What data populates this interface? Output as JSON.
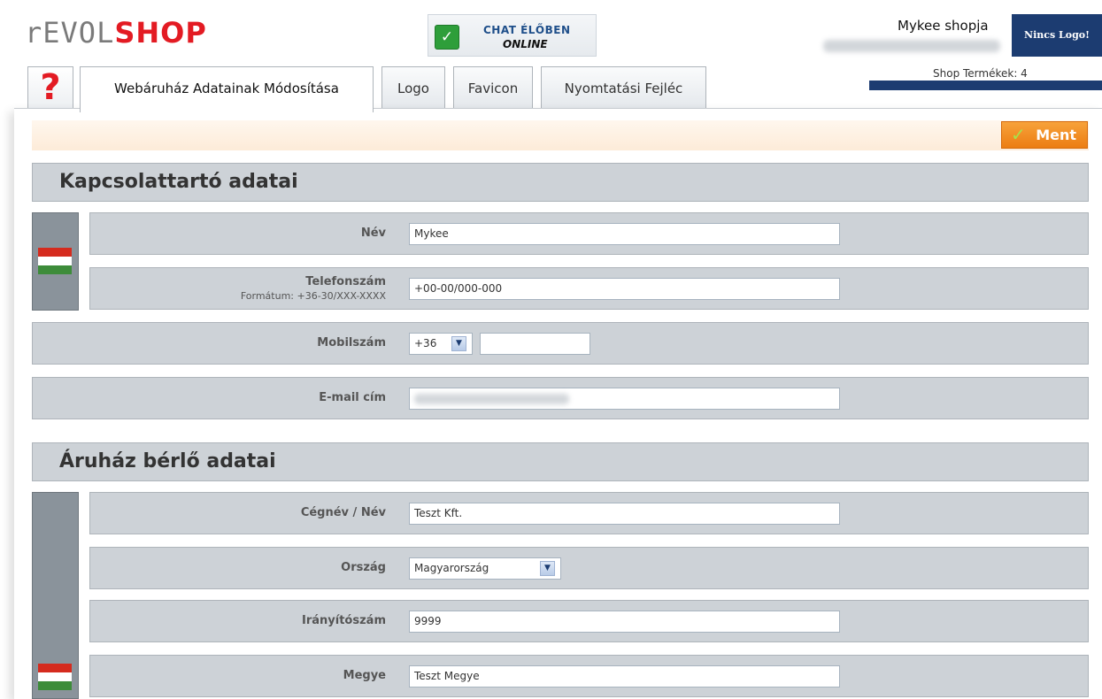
{
  "header": {
    "logo_part1": "rEVOL",
    "logo_part2": "SHOP",
    "chat_line1": "CHAT ÉLŐBEN",
    "chat_line2": "ONLINE",
    "shop_name": "Mykee shopja",
    "no_logo": "Nincs Logo!",
    "products_label": "Shop Termékek: 4"
  },
  "tabs": {
    "help": "?",
    "items": [
      {
        "label": "Webáruház Adatainak Módosítása"
      },
      {
        "label": "Logo"
      },
      {
        "label": "Favicon"
      },
      {
        "label": "Nyomtatási Fejléc"
      }
    ]
  },
  "toolbar": {
    "save_label": "Ment",
    "save_icon": "checkmark-icon"
  },
  "contact": {
    "title": "Kapcsolattartó adatai",
    "name_label": "Név",
    "name_value": "Mykee",
    "phone_label": "Telefonszám",
    "phone_hint": "Formátum: +36-30/XXX-XXXX",
    "phone_value": "+00-00/000-000",
    "mobile_label": "Mobilszám",
    "mobile_prefix": "+36",
    "mobile_value": "",
    "email_label": "E-mail cím"
  },
  "tenant": {
    "title": "Áruház bérlő adatai",
    "company_label": "Cégnév / Név",
    "company_value": "Teszt Kft.",
    "country_label": "Ország",
    "country_value": "Magyarország",
    "zip_label": "Irányítószám",
    "zip_value": "9999",
    "county_label": "Megye",
    "county_value": "Teszt Megye"
  },
  "colors": {
    "brand_red": "#e31b23",
    "navy": "#1c3c71",
    "save_orange": "#ec7d12",
    "row_bg": "#cdd2d7"
  }
}
